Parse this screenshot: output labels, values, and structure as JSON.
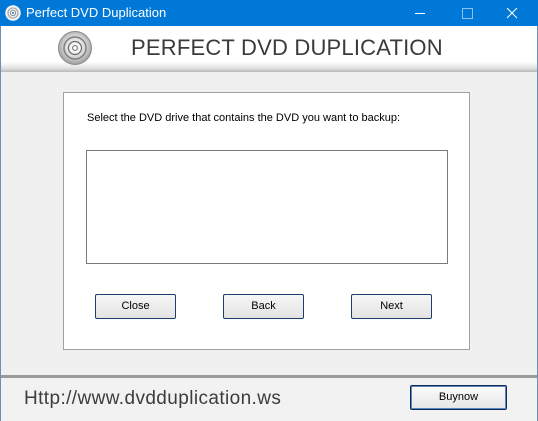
{
  "window": {
    "title": "Perfect DVD Duplication",
    "accent_color": "#0078d7",
    "controls": {
      "minimize_icon": "minimize-icon",
      "maximize_icon": "maximize-icon",
      "close_icon": "close-icon"
    }
  },
  "header": {
    "logo_icon": "dvd-disc-icon",
    "title": "PERFECT DVD DUPLICATION"
  },
  "main": {
    "instruction": "Select the DVD drive that contains the DVD you want to backup:",
    "drive_list": {
      "items": []
    },
    "buttons": {
      "close": "Close",
      "back": "Back",
      "next": "Next"
    }
  },
  "footer": {
    "url": "Http://www.dvdduplication.ws",
    "buynow": "Buynow"
  }
}
